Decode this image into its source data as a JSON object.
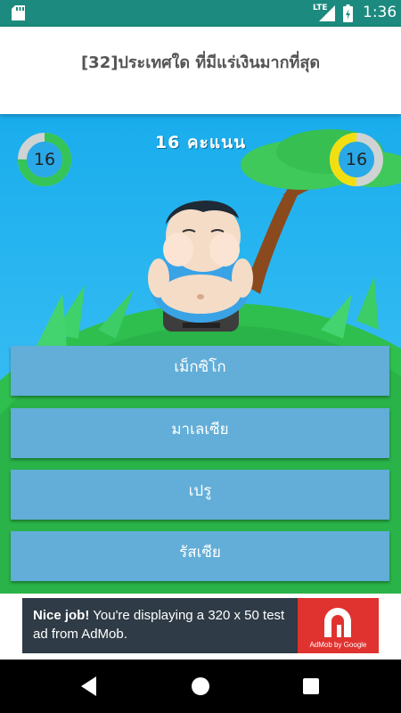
{
  "status_bar": {
    "network": "LTE",
    "time": "1:36",
    "icons": [
      "sd-card-icon",
      "signal-icon",
      "battery-charging-icon"
    ]
  },
  "question": {
    "text": "[32]ประเทศใด ที่มีแร่เงินมากที่สุด"
  },
  "score": {
    "label": "16 คะแนน"
  },
  "timers": {
    "left": {
      "value": "16",
      "progress": 0.75,
      "color": "#35c457",
      "track": "#cfd3d3"
    },
    "right": {
      "value": "16",
      "progress": 0.5,
      "color": "#f2df12",
      "track": "#cfd3d3"
    }
  },
  "answers": [
    {
      "label": "เม็กซิโก"
    },
    {
      "label": "มาเลเซีย"
    },
    {
      "label": "เปรู"
    },
    {
      "label": "รัสเซีย"
    }
  ],
  "ad": {
    "headline": "Nice job!",
    "body": "You're displaying a 320 x 50 test ad from AdMob.",
    "logo_caption": "AdMob by Google"
  },
  "nav": {
    "icons": [
      "back-icon",
      "home-icon",
      "recents-icon"
    ]
  },
  "colors": {
    "status_bar": "#1c8a7e",
    "answer_button": "#62aed8",
    "sky": "#27b5f0",
    "hill": "#2fbf4e",
    "ad_background": "#2f3b46",
    "admob_red": "#e0322f"
  }
}
